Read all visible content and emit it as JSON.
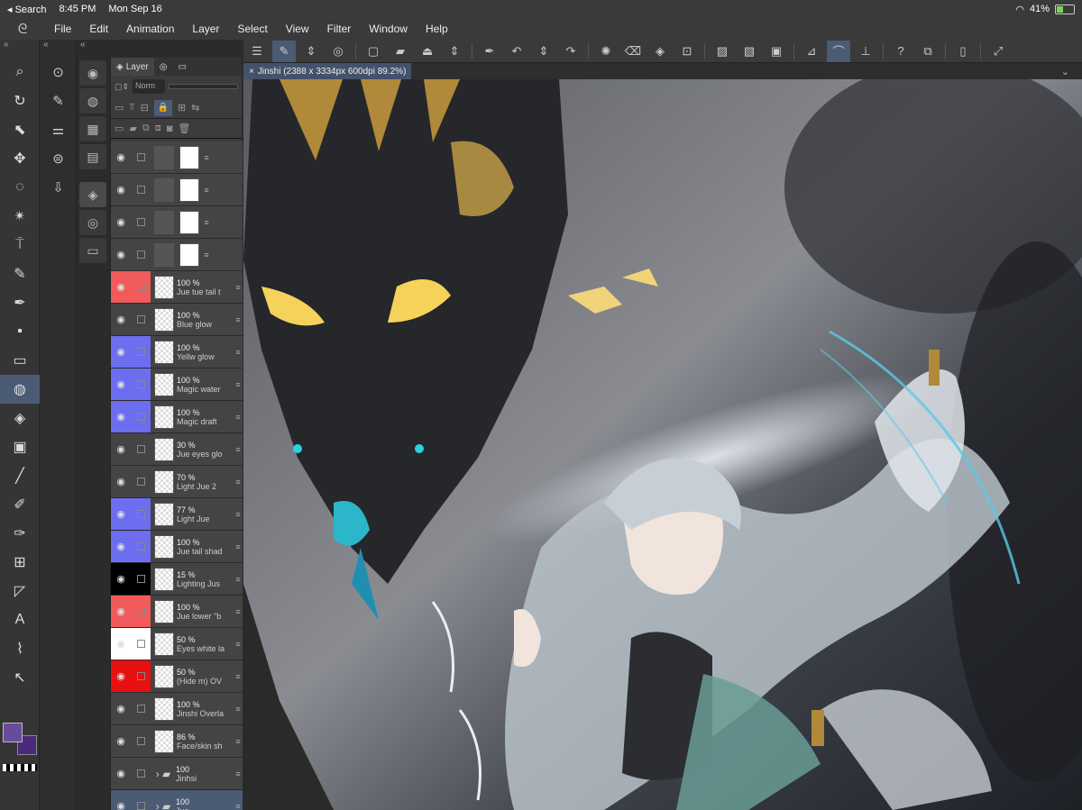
{
  "status": {
    "back_label": "◂ Search",
    "time": "8:45 PM",
    "date": "Mon Sep 16",
    "battery": "41%",
    "battery_level": 0.41
  },
  "menu": [
    "File",
    "Edit",
    "Animation",
    "Layer",
    "Select",
    "View",
    "Filter",
    "Window",
    "Help"
  ],
  "layer_panel": {
    "tab_label": "Layer",
    "blend_mode": "Norm",
    "layers": [
      {
        "opacity": "",
        "name": "",
        "color": "",
        "kind": "mask"
      },
      {
        "opacity": "",
        "name": "",
        "color": "",
        "kind": "mask"
      },
      {
        "opacity": "",
        "name": "",
        "color": "",
        "kind": "mask"
      },
      {
        "opacity": "",
        "name": "",
        "color": "",
        "kind": "mask"
      },
      {
        "opacity": "100 %",
        "name": "Jue tue tail t",
        "color": "#f05a5a",
        "kind": "raster"
      },
      {
        "opacity": "100 %",
        "name": "Blue glow",
        "color": "",
        "kind": "raster"
      },
      {
        "opacity": "100 %",
        "name": "Yellw glow",
        "color": "#6d6df0",
        "kind": "raster"
      },
      {
        "opacity": "100 %",
        "name": "Magic water",
        "color": "#6d6df0",
        "kind": "raster"
      },
      {
        "opacity": "100 %",
        "name": "Magic draft",
        "color": "#6d6df0",
        "kind": "raster"
      },
      {
        "opacity": "30 %",
        "name": "Jue eyes glo",
        "color": "",
        "kind": "raster"
      },
      {
        "opacity": "70 %",
        "name": "Light Jue 2",
        "color": "",
        "kind": "raster"
      },
      {
        "opacity": "77 %",
        "name": "Light Jue",
        "color": "#6d6df0",
        "kind": "raster"
      },
      {
        "opacity": "100 %",
        "name": "Jue tail shad",
        "color": "#6d6df0",
        "kind": "raster"
      },
      {
        "opacity": "15 %",
        "name": "Lighting Jus",
        "color": "#000000",
        "kind": "raster"
      },
      {
        "opacity": "100 %",
        "name": "Jue lower \"b",
        "color": "#f05a5a",
        "kind": "raster"
      },
      {
        "opacity": "50 %",
        "name": "Eyes white la",
        "color": "#ffffff",
        "kind": "raster"
      },
      {
        "opacity": "50 %",
        "name": "(Hide m) OV",
        "color": "#e81010",
        "kind": "raster"
      },
      {
        "opacity": "100 %",
        "name": "Jinshi Overla",
        "color": "",
        "kind": "raster"
      },
      {
        "opacity": "86 %",
        "name": "Face/skin sh",
        "color": "",
        "kind": "raster"
      },
      {
        "opacity": "100",
        "name": "Jinhsi",
        "color": "",
        "kind": "folder"
      },
      {
        "opacity": "100",
        "name": "Jue",
        "color": "",
        "kind": "folder"
      }
    ]
  },
  "canvas": {
    "tab_label": "Jinshi (2388 x 3334px 600dpi 89.2%)"
  }
}
